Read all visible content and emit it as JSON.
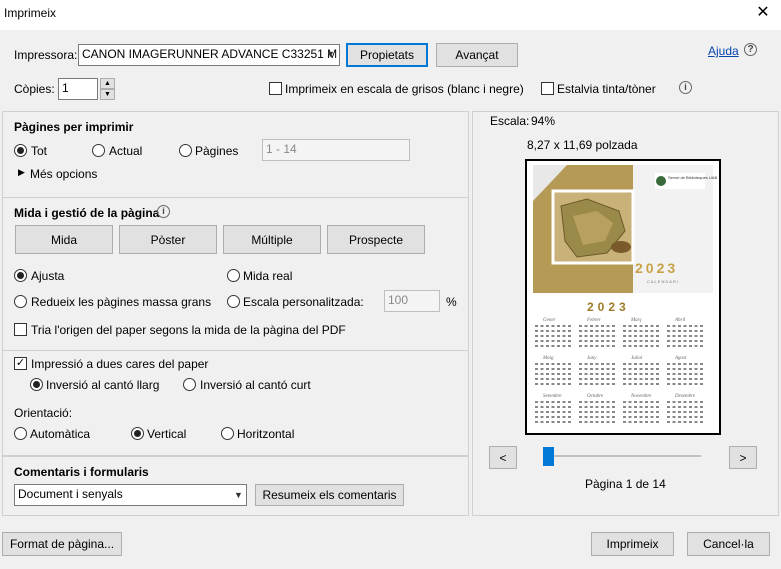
{
  "window": {
    "title": "Imprimeix"
  },
  "printer": {
    "label": "Impressora:",
    "selected": "CANON IMAGERUNNER ADVANCE C33251 M",
    "properties_button": "Propietats",
    "advanced_button": "Avançat",
    "help_link": "Ajuda"
  },
  "copies": {
    "label": "Còpies:",
    "value": "1",
    "grayscale_label": "Imprimeix en escala de grisos (blanc i negre)",
    "save_ink_label": "Estalvia tinta/tòner"
  },
  "pages": {
    "title": "Pàgines per imprimir",
    "all_label": "Tot",
    "current_label": "Actual",
    "pages_label": "Pàgines",
    "range_value": "1 - 14",
    "more_options": "Més opcions"
  },
  "sizing": {
    "title": "Mida i gestió de la pàgina",
    "tabs": [
      "Mida",
      "Pòster",
      "Múltiple",
      "Prospecte"
    ],
    "fit_label": "Ajusta",
    "actual_size_label": "Mida real",
    "shrink_label": "Redueix les pàgines massa grans",
    "custom_scale_label": "Escala personalitzada:",
    "custom_scale_value": "100",
    "percent": "%",
    "paper_source_label": "Tria l'origen del paper segons la mida de la pàgina del PDF"
  },
  "duplex": {
    "label": "Impressió a dues cares del paper",
    "long_edge": "Inversió al cantó llarg",
    "short_edge": "Inversió al cantó curt"
  },
  "orientation": {
    "label": "Orientació:",
    "auto": "Automàtica",
    "portrait": "Vertical",
    "landscape": "Horitzontal"
  },
  "comments": {
    "title": "Comentaris i formularis",
    "selected": "Document i senyals",
    "summarize_button": "Resumeix els comentaris"
  },
  "preview": {
    "scale_label": "Escala:",
    "scale_value": "94%",
    "dimensions": "8,27 x 11,69 polzada",
    "prev_button": "<",
    "next_button": ">",
    "page_indicator": "Pàgina 1 de 14",
    "slider_fraction": 0.0,
    "thumb": {
      "logo_text": "Servei de Biblioteques UAB",
      "year": "2023",
      "subtitle": "CALENDARI",
      "months": [
        "Gener",
        "Febrer",
        "Març",
        "Abril",
        "Maig",
        "Juny",
        "Juliol",
        "Agost",
        "Setembre",
        "Octubre",
        "Novembre",
        "Desembre"
      ]
    }
  },
  "footer": {
    "page_setup_button": "Format de pàgina...",
    "print_button": "Imprimeix",
    "cancel_button": "Cancel·la"
  },
  "colors": {
    "accent": "#0078d7",
    "map_gold": "#a08a4a",
    "map_brown": "#8a6a30"
  }
}
